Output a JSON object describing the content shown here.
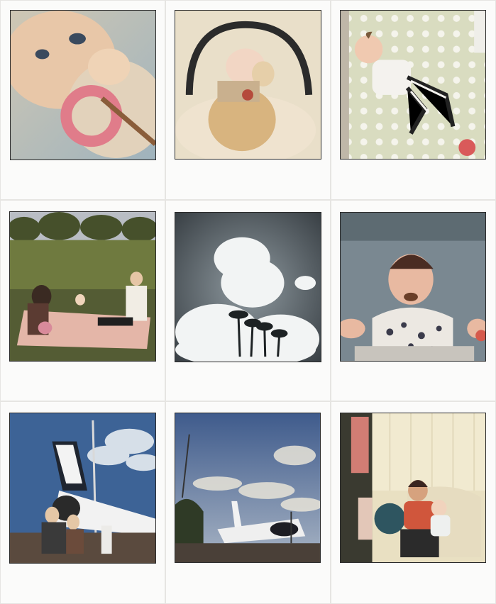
{
  "collage": {
    "photos": [
      {
        "subject": "baby-teether"
      },
      {
        "subject": "baby-in-bouncer"
      },
      {
        "subject": "baby-on-polka-dot-blanket"
      },
      {
        "subject": "family-picnic-in-park"
      },
      {
        "subject": "clouds-and-palm-trees"
      },
      {
        "subject": "baby-messy-face"
      },
      {
        "subject": "space-shuttle-group"
      },
      {
        "subject": "space-shuttle-street"
      },
      {
        "subject": "woman-holding-baby-in-chair"
      }
    ]
  },
  "colors": {
    "frame": "#fbfbfa",
    "page_background": "#f4f3f1",
    "photo_border": "#2a2a2a"
  }
}
